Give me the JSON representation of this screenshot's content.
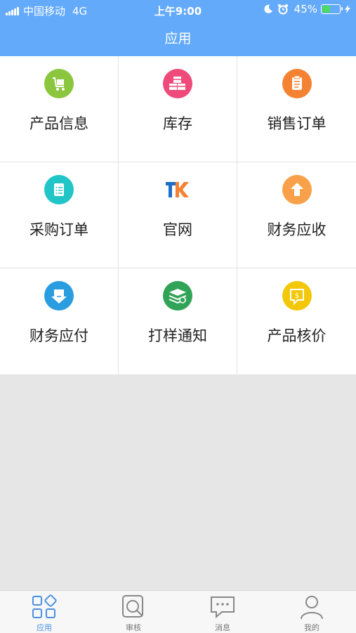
{
  "status_bar": {
    "carrier": "中国移动",
    "network": "4G",
    "time": "上午9:00",
    "battery": "45%",
    "battery_level": 0.45
  },
  "header": {
    "title": "应用"
  },
  "apps": [
    {
      "label": "产品信息",
      "icon": "cart-icon",
      "color": "#8cc63f"
    },
    {
      "label": "库存",
      "icon": "boxes-icon",
      "color": "#ee4a7a"
    },
    {
      "label": "销售订单",
      "icon": "clipboard-icon",
      "color": "#f58233"
    },
    {
      "label": "采购订单",
      "icon": "checklist-icon",
      "color": "#22c5c7"
    },
    {
      "label": "官网",
      "icon": "tk-logo-icon",
      "color": "#1e6ec8"
    },
    {
      "label": "财务应收",
      "icon": "up-arrow-icon",
      "color": "#f8a14a"
    },
    {
      "label": "财务应付",
      "icon": "down-arrow-icon",
      "color": "#2a9de0"
    },
    {
      "label": "打样通知",
      "icon": "money-stack-icon",
      "color": "#31a356"
    },
    {
      "label": "产品核价",
      "icon": "price-icon",
      "color": "#f3c80a"
    }
  ],
  "tabs": [
    {
      "label": "应用",
      "icon": "apps-grid-icon",
      "active": true
    },
    {
      "label": "审核",
      "icon": "review-icon",
      "active": false
    },
    {
      "label": "消息",
      "icon": "message-icon",
      "active": false
    },
    {
      "label": "我的",
      "icon": "person-icon",
      "active": false
    }
  ],
  "colors": {
    "header": "#64aafa",
    "tab_active": "#4a90e2",
    "tab_inactive": "#777777",
    "background": "#e6e6e6"
  }
}
